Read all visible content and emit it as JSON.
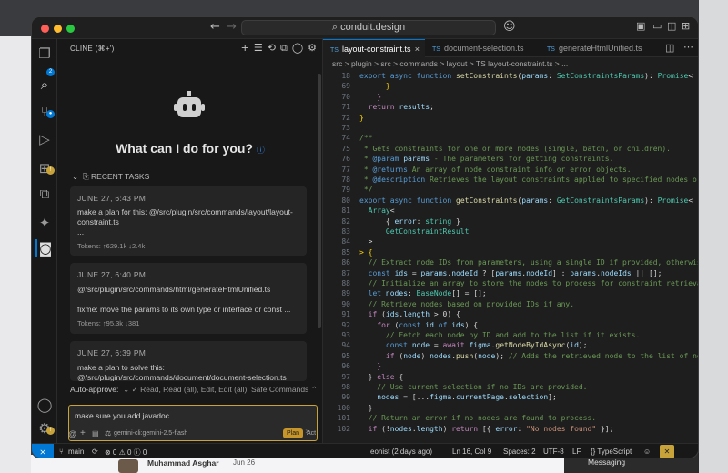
{
  "window": {
    "address": "conduit.design"
  },
  "panel": {
    "title": "CLINE (⌘+')",
    "heading": "What can I do for you?",
    "recent_label": "RECENT TASKS",
    "tasks": [
      {
        "date": "JUNE 27, 6:43 PM",
        "text": "make a plan for this: @/src/plugin/src/commands/layout/layout-constraint.ts",
        "extra": "...",
        "tokens": "Tokens: ↑629.1k ↓2.4k"
      },
      {
        "date": "JUNE 27, 6:40 PM",
        "text": "@/src/plugin/src/commands/html/generateHtmlUnified.ts",
        "extra": "fixme: move the params to its own type or interface or const ...",
        "tokens": "Tokens: ↑95.3k ↓381"
      },
      {
        "date": "JUNE 27, 6:39 PM",
        "text": "make a plan to solve this: @/src/plugin/src/commands/document/document-selection.ts",
        "extra": "",
        "tokens": ""
      }
    ],
    "auto_approve_label": "Auto-approve:",
    "auto_approve_value": "✓ Read, Read (all), Edit, Edit (all), Safe Commands",
    "input_value": "make sure you add javadoc",
    "model": "gemini-cli:gemini-2.5-flash",
    "plan_label": "Plan",
    "act_label": "Act"
  },
  "tabs": [
    {
      "label": "layout-constraint.ts",
      "prefix": "TS",
      "active": true
    },
    {
      "label": "document-selection.ts",
      "prefix": "TS",
      "active": false
    },
    {
      "label": "generateHtmlUnified.ts",
      "prefix": "TS",
      "active": false
    }
  ],
  "breadcrumb": "src > plugin > src > commands > layout > TS layout-constraint.ts > ...",
  "code_lines": [
    {
      "n": "18",
      "html": "<span class=\"k\">export</span> <span class=\"k\">async</span> <span class=\"k\">function</span> <span class=\"f\">setConstraints</span><span class=\"n\">(</span><span class=\"p\">params</span><span class=\"n\">: </span><span class=\"t\">SetConstraintsParams</span><span class=\"n\">): </span><span class=\"t\">Promise</span><span class=\"n\">&lt;</span>"
    },
    {
      "n": "69",
      "html": "<span class=\"n\">      </span><span class=\"y\">}</span>"
    },
    {
      "n": "70",
      "html": "<span class=\"n\">    </span><span class=\"kw\">}</span>"
    },
    {
      "n": "71",
      "html": "<span class=\"n\">  </span><span class=\"kw\">return</span><span class=\"n\"> </span><span class=\"p\">results</span><span class=\"n\">;</span>"
    },
    {
      "n": "72",
      "html": "<span class=\"y\">}</span>"
    },
    {
      "n": "73",
      "html": ""
    },
    {
      "n": "74",
      "html": "<span class=\"c\">/**</span>"
    },
    {
      "n": "75",
      "html": "<span class=\"c\"> * Gets constraints for one or more nodes (single, batch, or children).</span>"
    },
    {
      "n": "76",
      "html": "<span class=\"c\"> * </span><span class=\"k\">@param</span><span class=\"c\"> </span><span class=\"p\">params</span><span class=\"c\"> - The parameters for getting constraints.</span>"
    },
    {
      "n": "77",
      "html": "<span class=\"c\"> * </span><span class=\"k\">@returns</span><span class=\"c\"> An array of node constraint info or error objects.</span>"
    },
    {
      "n": "78",
      "html": "<span class=\"c\"> * </span><span class=\"k\">@description</span><span class=\"c\"> Retrieves the layout constraints applied to specified nodes or th</span>"
    },
    {
      "n": "79",
      "html": "<span class=\"c\"> */</span>"
    },
    {
      "n": "80",
      "html": "<span class=\"k\">export</span> <span class=\"k\">async</span> <span class=\"k\">function</span> <span class=\"f\">getConstraints</span><span class=\"n\">(</span><span class=\"p\">params</span><span class=\"n\">: </span><span class=\"t\">GetConstraintsParams</span><span class=\"n\">): </span><span class=\"t\">Promise</span><span class=\"n\">&lt;</span>"
    },
    {
      "n": "81",
      "html": "<span class=\"n\">  </span><span class=\"t\">Array</span><span class=\"n\">&lt;</span>"
    },
    {
      "n": "82",
      "html": "<span class=\"n\">    | { </span><span class=\"p\">error</span><span class=\"n\">: </span><span class=\"t\">string</span><span class=\"n\"> }</span>"
    },
    {
      "n": "83",
      "html": "<span class=\"n\">    | </span><span class=\"t\">GetConstraintResult</span>"
    },
    {
      "n": "84",
      "html": "<span class=\"n\">  &gt;</span>"
    },
    {
      "n": "85",
      "html": "<span class=\"y\">&gt; {</span>"
    },
    {
      "n": "86",
      "html": "<span class=\"n\">  </span><span class=\"c\">// Extract node IDs from parameters, using a single ID if provided, otherwise a</span>"
    },
    {
      "n": "87",
      "html": "<span class=\"n\">  </span><span class=\"k\">const</span><span class=\"n\"> </span><span class=\"p\">ids</span><span class=\"n\"> = </span><span class=\"p\">params</span><span class=\"n\">.</span><span class=\"p\">nodeId</span><span class=\"n\"> ? [</span><span class=\"p\">params</span><span class=\"n\">.</span><span class=\"p\">nodeId</span><span class=\"n\">] : </span><span class=\"p\">params</span><span class=\"n\">.</span><span class=\"p\">nodeIds</span><span class=\"n\"> || [];</span>"
    },
    {
      "n": "88",
      "html": "<span class=\"n\">  </span><span class=\"c\">// Initialize an array to store the nodes to process for constraint retrieval.</span>"
    },
    {
      "n": "89",
      "html": "<span class=\"n\">  </span><span class=\"k\">let</span><span class=\"n\"> </span><span class=\"p\">nodes</span><span class=\"n\">: </span><span class=\"t\">BaseNode</span><span class=\"n\">[] = [];</span>"
    },
    {
      "n": "90",
      "html": "<span class=\"n\">  </span><span class=\"c\">// Retrieve nodes based on provided IDs if any.</span>"
    },
    {
      "n": "91",
      "html": "<span class=\"n\">  </span><span class=\"kw\">if</span><span class=\"n\"> (</span><span class=\"p\">ids</span><span class=\"n\">.</span><span class=\"p\">length</span><span class=\"n\"> &gt; 0) {</span>"
    },
    {
      "n": "92",
      "html": "<span class=\"n\">    </span><span class=\"kw\">for</span><span class=\"n\"> (</span><span class=\"k\">const</span><span class=\"n\"> </span><span class=\"p\">id</span><span class=\"n\"> </span><span class=\"k\">of</span><span class=\"n\"> </span><span class=\"p\">ids</span><span class=\"n\">) {</span>"
    },
    {
      "n": "93",
      "html": "<span class=\"n\">      </span><span class=\"c\">// Fetch each node by ID and add to the list if it exists.</span>"
    },
    {
      "n": "94",
      "html": "<span class=\"n\">      </span><span class=\"k\">const</span><span class=\"n\"> </span><span class=\"p\">node</span><span class=\"n\"> = </span><span class=\"kw\">await</span><span class=\"n\"> </span><span class=\"p\">figma</span><span class=\"n\">.</span><span class=\"f\">getNodeByIdAsync</span><span class=\"n\">(</span><span class=\"p\">id</span><span class=\"n\">);</span>"
    },
    {
      "n": "95",
      "html": "<span class=\"n\">      </span><span class=\"kw\">if</span><span class=\"n\"> (</span><span class=\"p\">node</span><span class=\"n\">) </span><span class=\"p\">nodes</span><span class=\"n\">.</span><span class=\"f\">push</span><span class=\"n\">(</span><span class=\"p\">node</span><span class=\"n\">); </span><span class=\"c\">// Adds the retrieved node to the list of nodes</span>"
    },
    {
      "n": "96",
      "html": "<span class=\"n\">    </span><span class=\"kw\">}</span>"
    },
    {
      "n": "97",
      "html": "<span class=\"n\">  } </span><span class=\"kw\">else</span><span class=\"n\"> {</span>"
    },
    {
      "n": "98",
      "html": "<span class=\"n\">    </span><span class=\"c\">// Use current selection if no IDs are provided.</span>"
    },
    {
      "n": "99",
      "html": "<span class=\"n\">    </span><span class=\"p\">nodes</span><span class=\"n\"> = [...</span><span class=\"p\">figma</span><span class=\"n\">.</span><span class=\"p\">currentPage</span><span class=\"n\">.</span><span class=\"p\">selection</span><span class=\"n\">];</span>"
    },
    {
      "n": "100",
      "html": "<span class=\"n\">  }</span>"
    },
    {
      "n": "101",
      "html": "<span class=\"n\">  </span><span class=\"c\">// Return an error if no nodes are found to process.</span>"
    },
    {
      "n": "102",
      "html": "<span class=\"n\">  </span><span class=\"kw\">if</span><span class=\"n\"> (!</span><span class=\"p\">nodes</span><span class=\"n\">.</span><span class=\"p\">length</span><span class=\"n\">) </span><span class=\"kw\">return</span><span class=\"n\"> [{ </span><span class=\"p\">error</span><span class=\"n\">: </span><span class=\"s\">\"No nodes found\"</span><span class=\"n\"> }];</span>"
    }
  ],
  "status": {
    "branch": "main",
    "problems": "⊗ 0 ⚠ 0 ⓘ 0",
    "blame": "eonist (2 days ago)",
    "position": "Ln 16, Col 9",
    "spaces": "Spaces: 2",
    "encoding": "UTF-8",
    "eol": "LF",
    "language": "{} TypeScript"
  },
  "overlay": {
    "user": "Muhammad Asghar",
    "date": "Jun 26",
    "messaging": "Messaging"
  }
}
